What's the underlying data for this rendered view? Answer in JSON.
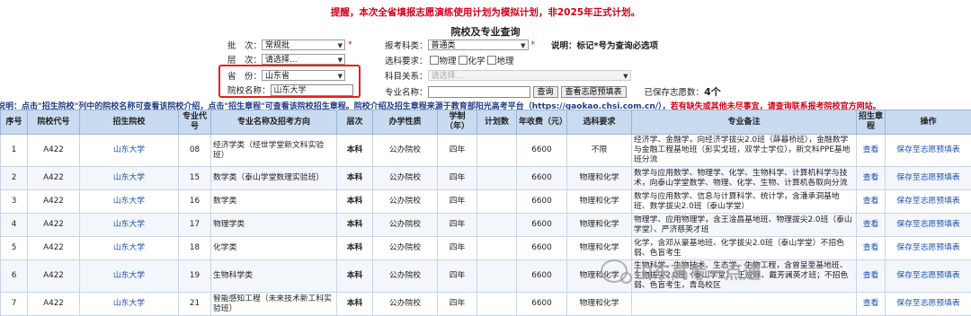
{
  "notice": "提醒，本次全省填报志愿演练使用计划为模拟计划，非2025年正式计划。",
  "title": "院校及专业查询",
  "form": {
    "batch_label": "批　次：",
    "batch_value": "常规批",
    "level_label": "层　次：",
    "level_value": "请选择...",
    "province_label": "省　份：",
    "province_value": "山东省",
    "school_label": "院校名称：",
    "school_value": "山东大学",
    "category_label": "报考科类：",
    "category_value": "普通类",
    "required_mark": "*",
    "note": "说明：标记*号为查询必选项",
    "subject_req_label": "选科要求：",
    "subject_opts": [
      "物理",
      "化学",
      "地理"
    ],
    "subject_rel_label": "科目关系：",
    "subject_rel_value": "请选择...",
    "major_label": "专业名称：",
    "query_button": "查询",
    "fill_button": "查看志愿预填表",
    "saved_label": "已保存志愿数：",
    "saved_count": "4个"
  },
  "guide": {
    "part1": "说明：点击\"招生院校\"列中的院校名称可查看该院校介绍，点击\"招生章程\"可查看该院校招生章程。院校介绍及招生章程来源于教育部阳光高考平台（https://gaokao.chsi.com.cn/），",
    "part2": "若有缺失或其他未尽事宜，请查询联系报考院校官方网站。"
  },
  "table": {
    "headers": [
      "序号",
      "院校代号",
      "招生院校",
      "专业代号",
      "专业名称及招考方向",
      "层次",
      "办学性质",
      "学制（年）",
      "计划数",
      "年收费（元）",
      "选科要求",
      "专业备注",
      "招生章程",
      "操作"
    ],
    "view_label": "查看",
    "save_label": "保存至志愿预填表",
    "rows": [
      {
        "no": "1",
        "code": "A422",
        "school": "山东大学",
        "mcode": "08",
        "major": "经济学类（经世学堂新文科实验班）",
        "level": "本科",
        "nature": "公办院校",
        "years": "四年",
        "plan": "",
        "fee": "6600",
        "req": "不限",
        "remark": "经济学、金融学，向经济学拔尖2.0班（薛暮桥班），金融数学与金融工程基地班（彭实戈班，双学士学位），新文科PPE基地班分流"
      },
      {
        "no": "2",
        "code": "A422",
        "school": "山东大学",
        "mcode": "15",
        "major": "数学类（泰山学堂数理实验班）",
        "level": "本科",
        "nature": "公办院校",
        "years": "四年",
        "plan": "",
        "fee": "6600",
        "req": "物理和化学",
        "remark": "数学与应用数学、物理学、化学、生物科学、计算机科学与技术，向泰山学堂数学、物理、化学、生物、计算机各取向分流"
      },
      {
        "no": "3",
        "code": "A422",
        "school": "山东大学",
        "mcode": "16",
        "major": "数学类",
        "level": "本科",
        "nature": "公办院校",
        "years": "四年",
        "plan": "",
        "fee": "6600",
        "req": "物理和化学",
        "remark": "数学与应用数学、信息与计算科学、统计学，含潘承洞基地班、数学拔尖2.0班（泰山学堂）"
      },
      {
        "no": "4",
        "code": "A422",
        "school": "山东大学",
        "mcode": "17",
        "major": "物理学类",
        "level": "本科",
        "nature": "公办院校",
        "years": "四年",
        "plan": "",
        "fee": "6600",
        "req": "物理和化学",
        "remark": "物理学、应用物理学，含王淦昌基地班、物理拔尖2.0班（泰山学堂）、严济慈英才班"
      },
      {
        "no": "5",
        "code": "A422",
        "school": "山东大学",
        "mcode": "18",
        "major": "化学类",
        "level": "本科",
        "nature": "公办院校",
        "years": "四年",
        "plan": "",
        "fee": "6600",
        "req": "物理和化学",
        "remark": "化学，含邓从豪基地班、化学拔尖2.0班（泰山学堂）不招色弱、色盲考生"
      },
      {
        "no": "6",
        "code": "A422",
        "school": "山东大学",
        "mcode": "19",
        "major": "生物科学类",
        "level": "本科",
        "nature": "公办院校",
        "years": "四年",
        "plan": "",
        "fee": "6600",
        "req": "物理和化学",
        "remark": "生物科学、生物技术、生态学、生物工程，含曾呈奎基地班、生物拔尖2.0班（泰山学堂）、王应睐、戴芳澜英才班；不招色弱、色盲考生，青岛校区"
      },
      {
        "no": "7",
        "code": "A422",
        "school": "山东大学",
        "mcode": "21",
        "major": "智能感知工程（未来技术新工科实验班）",
        "level": "本科",
        "nature": "公办院校",
        "years": "四年",
        "plan": "",
        "fee": "6600",
        "req": "物理和化学",
        "remark": ""
      }
    ]
  },
  "watermark": "山东高考一点通"
}
